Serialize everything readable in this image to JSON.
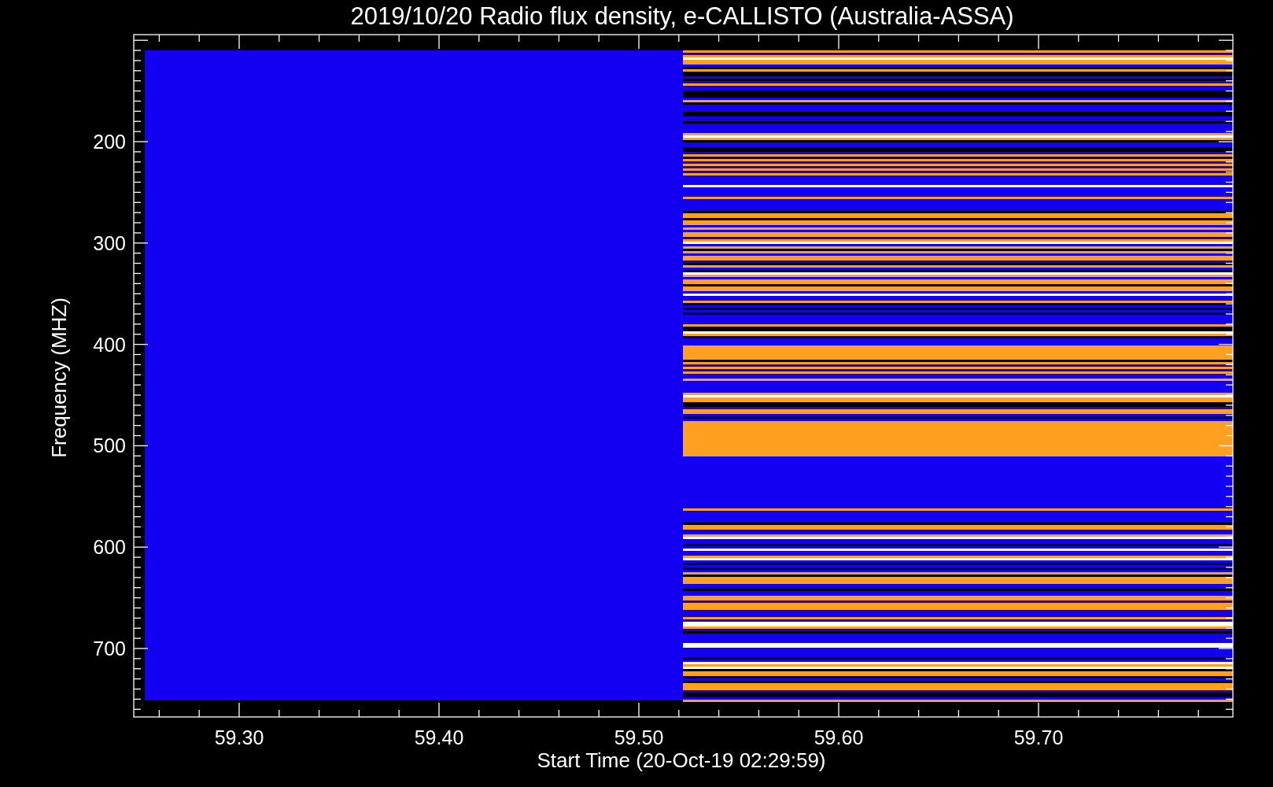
{
  "chart": {
    "title": "2019/10/20  Radio flux density, e-CALLISTO (Australia-ASSA)",
    "xlabel": "Start Time (20-Oct-19 02:29:59)",
    "ylabel": "Frequency (MHZ)",
    "xticks": [
      "59.30",
      "59.40",
      "59.50",
      "59.60",
      "59.70"
    ],
    "yticks": [
      "200",
      "300",
      "400",
      "500",
      "600",
      "700"
    ]
  }
}
